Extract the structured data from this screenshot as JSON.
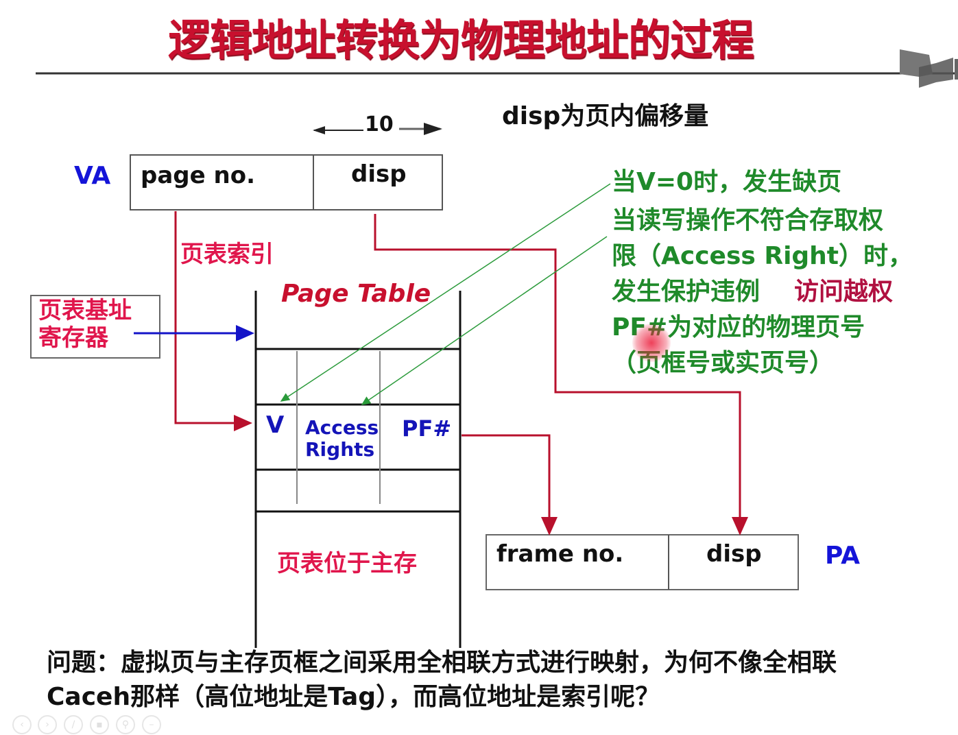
{
  "slide": {
    "title": "逻辑地址转换为物理地址的过程",
    "disp_note": "disp为页内偏移量",
    "disp_width": "10",
    "va": {
      "label": "VA",
      "fields": [
        "page no.",
        "disp"
      ]
    },
    "pa": {
      "label": "PA",
      "fields": [
        "frame no.",
        "disp"
      ]
    },
    "page_table_index_label": "页表索引",
    "page_table_base_register": [
      "页表基址",
      "寄存器"
    ],
    "page_table": {
      "title": "Page Table",
      "entry": {
        "v": "V",
        "access_rights": [
          "Access",
          "Rights"
        ],
        "pf": "PF#"
      },
      "location_note": "页表位于主存"
    },
    "notes": {
      "page_fault": "当V=0时，发生缺页",
      "protection_lines": [
        "当读写操作不符合存取权",
        "限（Access Right）时，",
        "发生保护违例"
      ],
      "protection_tag": "访问越权",
      "pf_lines": [
        "PF#为对应的物理页号",
        "（页框号或实页号）"
      ]
    },
    "question_lines": [
      "问题：虚拟页与主存页框之间采用全相联方式进行映射，为何不像全相联",
      "Caceh那样（高位地址是Tag），而高位地址是索引呢？"
    ]
  },
  "colors": {
    "title": "#c8102e",
    "blue": "#1414d8",
    "red_label": "#e0164c",
    "green": "#1f8a2a",
    "arrow_red": "#b8102c",
    "arrow_orange_red": "#c0392b"
  },
  "player_controls": [
    "prev-icon",
    "next-icon",
    "pen-icon",
    "menu-icon",
    "zoom-icon",
    "more-icon"
  ]
}
